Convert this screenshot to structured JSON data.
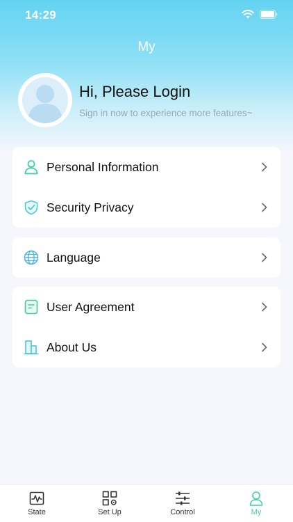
{
  "status_bar": {
    "time": "14:29"
  },
  "header": {
    "title": "My"
  },
  "profile": {
    "title": "Hi, Please Login",
    "subtitle": "Sign in now to experience more features~"
  },
  "menu": {
    "group1": [
      {
        "label": "Personal Information",
        "icon": "person-icon"
      },
      {
        "label": "Security Privacy",
        "icon": "shield-icon"
      }
    ],
    "group2": [
      {
        "label": "Language",
        "icon": "globe-icon"
      }
    ],
    "group3": [
      {
        "label": "User Agreement",
        "icon": "document-icon"
      },
      {
        "label": "About Us",
        "icon": "building-icon"
      }
    ]
  },
  "tabbar": {
    "tabs": [
      {
        "label": "State",
        "icon": "waveform-icon"
      },
      {
        "label": "Set Up",
        "icon": "grid-settings-icon"
      },
      {
        "label": "Control",
        "icon": "sliders-icon"
      },
      {
        "label": "My",
        "icon": "user-icon"
      }
    ],
    "active": "My"
  },
  "colors": {
    "accent": "#3fd0a6",
    "header_top": "#63d3f2",
    "icon_teal": "#4cc9c0",
    "background": "#f6f7fd"
  }
}
